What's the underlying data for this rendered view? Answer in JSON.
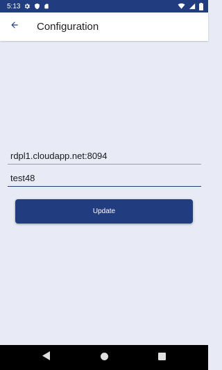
{
  "status_bar": {
    "time": "5:13",
    "left_icons": [
      "settings-icon",
      "shield-icon",
      "sd-card-icon"
    ],
    "right_icons": [
      "wifi-icon",
      "signal-icon",
      "battery-icon"
    ]
  },
  "app_bar": {
    "title": "Configuration",
    "back_icon": "arrow-left-icon"
  },
  "form": {
    "host_value": "rdpl1.cloudapp.net:8094",
    "user_value": "test48",
    "update_label": "Update"
  },
  "nav_bar": {
    "icons": [
      "back-triangle-icon",
      "home-circle-icon",
      "recents-square-icon"
    ]
  },
  "colors": {
    "primary": "#223d7f",
    "background": "#e8ebf5",
    "app_bar": "#ffffff",
    "nav_bar": "#000000"
  }
}
